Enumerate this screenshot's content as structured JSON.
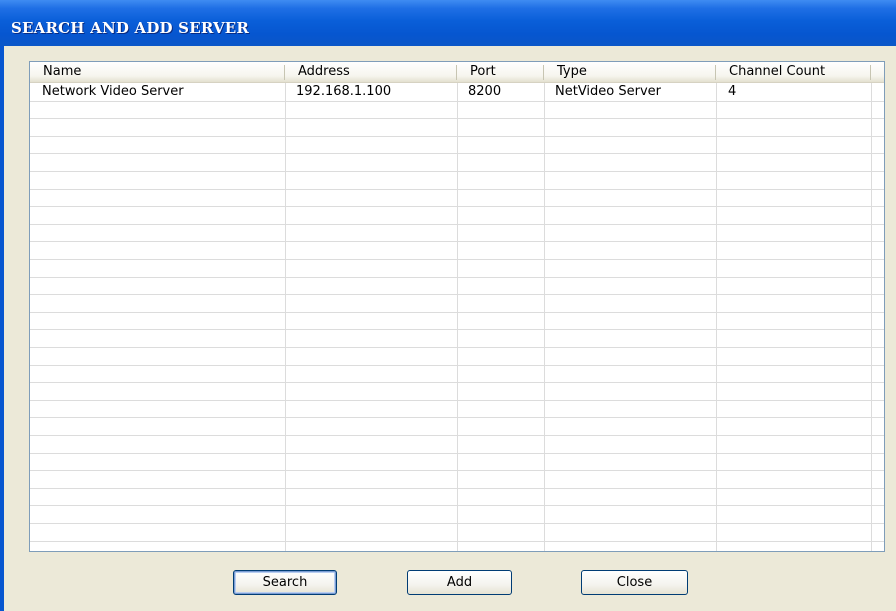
{
  "window": {
    "title": "SEARCH AND ADD SERVER"
  },
  "table": {
    "columns": [
      "Name",
      "Address",
      "Port",
      "Type",
      "Channel Count"
    ],
    "rows": [
      [
        "Network Video Server",
        "192.168.1.100",
        "8200",
        "NetVideo Server",
        "4"
      ]
    ]
  },
  "buttons": {
    "search": "Search",
    "add": "Add",
    "close": "Close"
  },
  "colors": {
    "titlebar": "#0656d0",
    "dialog_background": "#ece9d8",
    "button_border": "#003c74"
  }
}
